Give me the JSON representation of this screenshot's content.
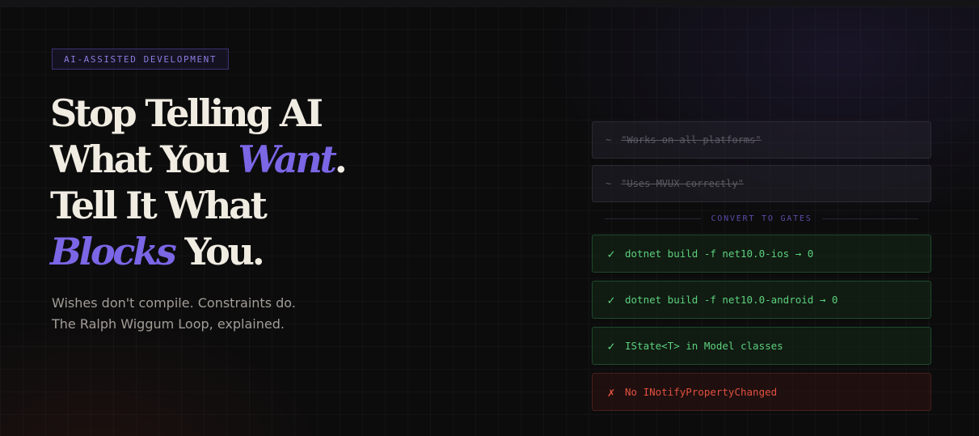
{
  "badge": "AI-ASSISTED DEVELOPMENT",
  "headline": {
    "line1": "Stop Telling AI",
    "line2_pre": "What You ",
    "line2_accent": "Want",
    "line2_post": ".",
    "line3": "Tell It What",
    "line4_accent": "Blocks",
    "line4_post": " You."
  },
  "subtitle": {
    "line1": "Wishes don't compile. Constraints do.",
    "line2": "The Ralph Wiggum Loop, explained."
  },
  "wishes": [
    {
      "prefix": "~",
      "text": "\"Works on all platforms\""
    },
    {
      "prefix": "~",
      "text": "\"Uses MVUX correctly\""
    }
  ],
  "divider_label": "CONVERT TO GATES",
  "gates": [
    {
      "status": "pass",
      "mark": "✓",
      "text": "dotnet build -f net10.0-ios → 0"
    },
    {
      "status": "pass",
      "mark": "✓",
      "text": "dotnet build -f net10.0-android → 0"
    },
    {
      "status": "pass",
      "mark": "✓",
      "text": "IState<T> in Model classes"
    },
    {
      "status": "fail",
      "mark": "✗",
      "text": "No INotifyPropertyChanged"
    }
  ],
  "colors": {
    "accent": "#7b66e6",
    "pass": "#5cd17c",
    "fail": "#e2503e",
    "headline": "#f1ece2"
  }
}
